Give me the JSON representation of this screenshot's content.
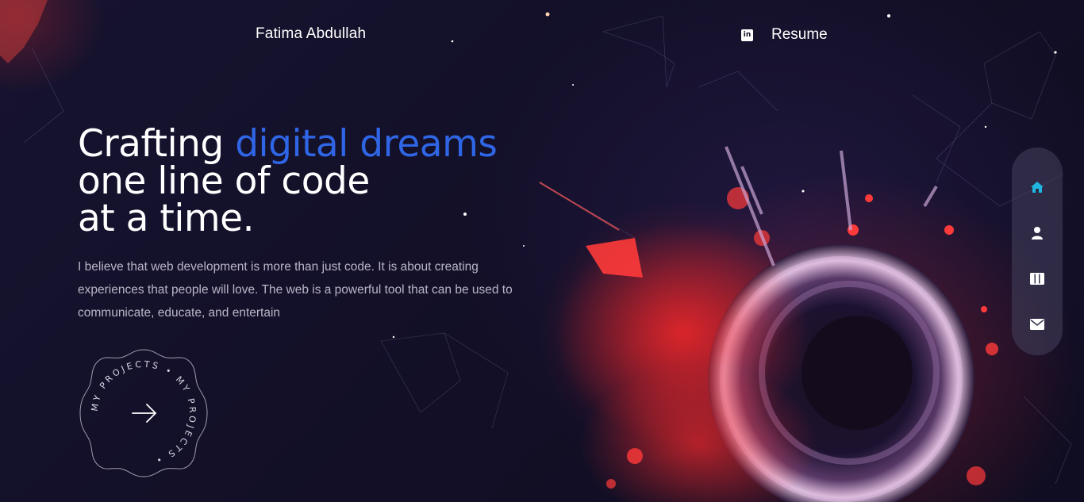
{
  "header": {
    "name": "Fatima Abdullah",
    "resume_label": "Resume",
    "linkedin_icon_glyph": "in"
  },
  "hero": {
    "title_part1": "Crafting ",
    "title_accent": "digital dreams",
    "title_line2": "one line of code",
    "title_line3": "at a time.",
    "description": "I believe that web development is more than just code. It is about creating experiences that people will love. The web is a powerful tool that can be used to communicate, educate, and entertain",
    "accent_color": "#2f66e6"
  },
  "projects_badge": {
    "ring_text": "MY PROJECTS • MY PROJECTS •",
    "icon": "arrow-right-icon"
  },
  "side_nav": {
    "items": [
      {
        "name": "home",
        "icon": "home-icon",
        "active": true,
        "color": "#1fb6e0"
      },
      {
        "name": "about",
        "icon": "user-icon",
        "active": false
      },
      {
        "name": "projects",
        "icon": "columns-icon",
        "active": false
      },
      {
        "name": "contact",
        "icon": "mail-icon",
        "active": false
      }
    ]
  }
}
